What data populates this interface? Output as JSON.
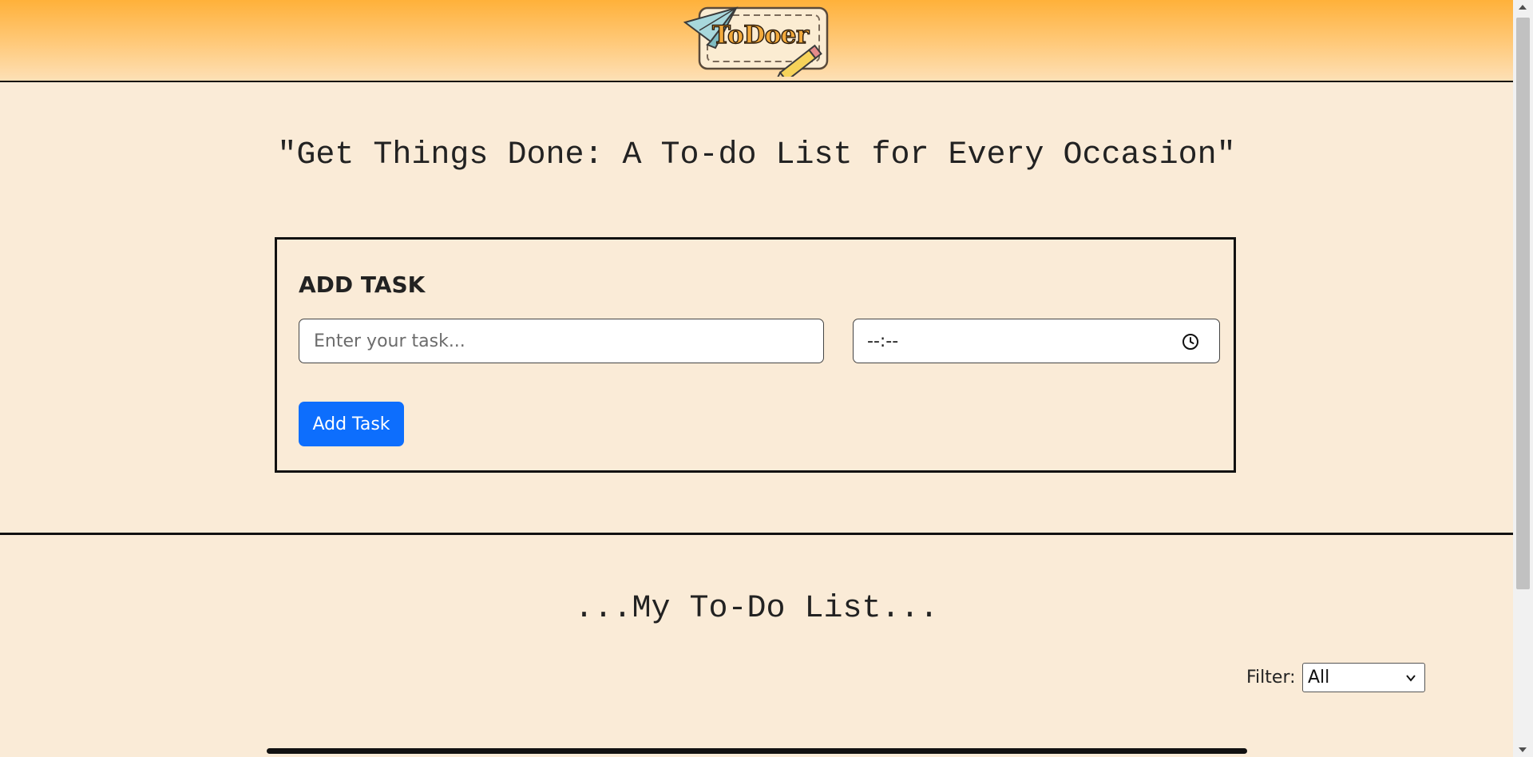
{
  "header": {
    "logo_text": "ToDoer",
    "logo_icon": "paper-plane-and-pencil-logo"
  },
  "main": {
    "headline": "\"Get Things Done: A To-do List for Every Occasion\"",
    "add_task": {
      "title": "ADD TASK",
      "task_placeholder": "Enter your task...",
      "time_value": "--:--",
      "time_icon": "clock-icon",
      "button_label": "Add Task"
    }
  },
  "list": {
    "title": "...My To-Do List...",
    "filter_label": "Filter:",
    "filter_selected": "All",
    "filter_icon": "chevron-down-icon"
  },
  "colors": {
    "background": "#faebd7",
    "header_gradient_top": "#ffb13a",
    "header_gradient_bottom": "#fde0b6",
    "button": "#0d6efd"
  }
}
